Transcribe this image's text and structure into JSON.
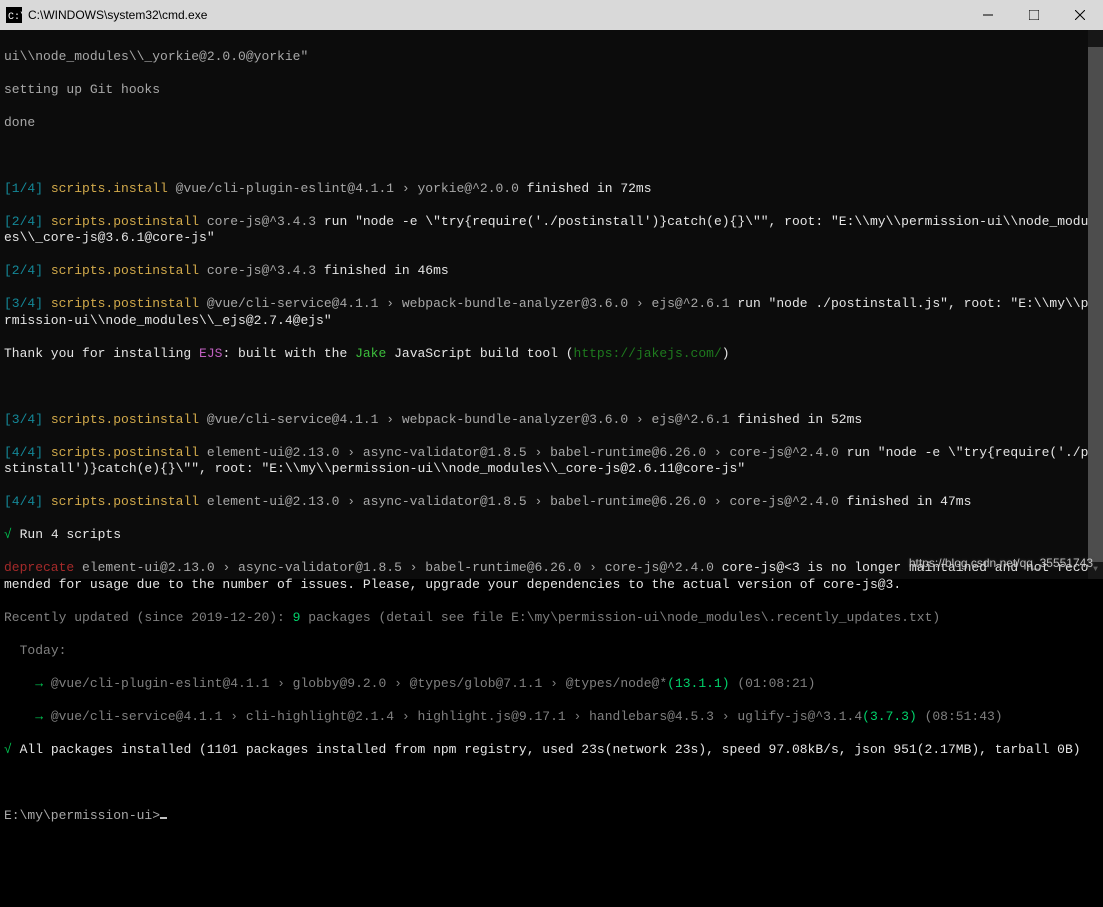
{
  "window": {
    "title": "C:\\WINDOWS\\system32\\cmd.exe"
  },
  "lines": {
    "l0": "ui\\\\node_modules\\\\_yorkie@2.0.0@yorkie\"",
    "l1": "setting up Git hooks",
    "l2": "done",
    "s1a": "[1/4]",
    "s1b": " scripts.install",
    "s1c": " @vue/cli-plugin-eslint@4.1.1 › yorkie@^2.0.0",
    "s1d": " finished in 72ms",
    "s2a": "[2/4]",
    "s2b": " scripts.postinstall",
    "s2c": " core-js@^3.4.3",
    "s2d": " run \"node -e \\\"try{require('./postinstall')}catch(e){}\\\"\", root: \"E:\\\\my\\\\permission-ui\\\\node_modules\\\\_core-js@3.6.1@core-js\"",
    "s3a": "[2/4]",
    "s3b": " scripts.postinstall",
    "s3c": " core-js@^3.4.3",
    "s3d": " finished in 46ms",
    "s4a": "[3/4]",
    "s4b": " scripts.postinstall",
    "s4c": " @vue/cli-service@4.1.1 › webpack-bundle-analyzer@3.6.0 › ejs@^2.6.1",
    "s4d": " run \"node ./postinstall.js\", root: \"E:\\\\my\\\\permission-ui\\\\node_modules\\\\_ejs@2.7.4@ejs\"",
    "thank1": "Thank you for installing ",
    "ejs": "EJS",
    "thank2": ": built with the ",
    "jake": "Jake",
    "thank3": " JavaScript build tool (",
    "jakejs": "https://jakejs.com/",
    "thank4": ")",
    "s5a": "[3/4]",
    "s5b": " scripts.postinstall",
    "s5c": " @vue/cli-service@4.1.1 › webpack-bundle-analyzer@3.6.0 › ejs@^2.6.1",
    "s5d": " finished in 52ms",
    "s6a": "[4/4]",
    "s6b": " scripts.postinstall",
    "s6c": " element-ui@2.13.0 › async-validator@1.8.5 › babel-runtime@6.26.0 › core-js@^2.4.0",
    "s6d": " run \"node -e \\\"try{require('./postinstall')}catch(e){}\\\"\", root: \"E:\\\\my\\\\permission-ui\\\\node_modules\\\\_core-js@2.6.11@core-js\"",
    "s7a": "[4/4]",
    "s7b": " scripts.postinstall",
    "s7c": " element-ui@2.13.0 › async-validator@1.8.5 › babel-runtime@6.26.0 › core-js@^2.4.0",
    "s7d": " finished in 47ms",
    "run4": " Run 4 scripts",
    "dep1": "deprecate",
    "dep2": " element-ui@2.13.0 › async-validator@1.8.5 › babel-runtime@6.26.0 › core-js@^2.4.0",
    "dep3": " core-js@<3 is no longer maintained and not recommended for usage due to the number of issues. Please, upgrade your dependencies to the actual version of core-js@3.",
    "recent1": "Recently updated (since 2019-12-20): ",
    "recent2": "9",
    "recent3": " packages (detail see file E:\\my\\permission-ui\\node_modules\\.recently_updates.txt)",
    "today": "  Today:",
    "u1a": "    → ",
    "u1b": "@vue/cli-plugin-eslint@4.1.1 › globby@9.2.0 › @types/glob@7.1.1 › @types/node@*",
    "u1c": "(13.1.1)",
    "u1d": " (01:08:21)",
    "u2a": "    → ",
    "u2b": "@vue/cli-service@4.1.1 › cli-highlight@2.1.4 › highlight.js@9.17.1 › handlebars@4.5.3 › uglify-js@^3.1.4",
    "u2c": "(3.7.3)",
    "u2d": " (08:51:43)",
    "allpkg": " All packages installed (1101 packages installed from npm registry, used 23s(network 23s), speed 97.08kB/s, json 951(2.17MB), tarball 0B)",
    "prompt": "E:\\my\\permission-ui>"
  },
  "watermark": "https://blog.csdn.net/qq_35551743"
}
